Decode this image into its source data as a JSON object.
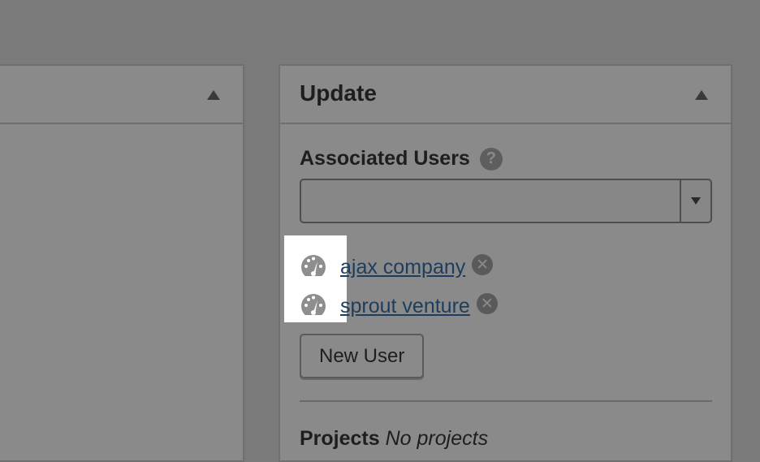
{
  "update_panel": {
    "title": "Update",
    "associated_users": {
      "label": "Associated Users",
      "help_glyph": "?",
      "users": [
        {
          "name": "ajax company",
          "icon": "dashboard-icon"
        },
        {
          "name": "sprout venture",
          "icon": "dashboard-icon"
        }
      ],
      "remove_glyph": "✕"
    },
    "new_user_button": "New User",
    "projects_label": "Projects",
    "projects_value": "No projects"
  },
  "colors": {
    "overlay": "#7a7a7a",
    "panel": "#8a8a8a",
    "link": "#1e3d5c",
    "highlight": "#ffffff"
  }
}
